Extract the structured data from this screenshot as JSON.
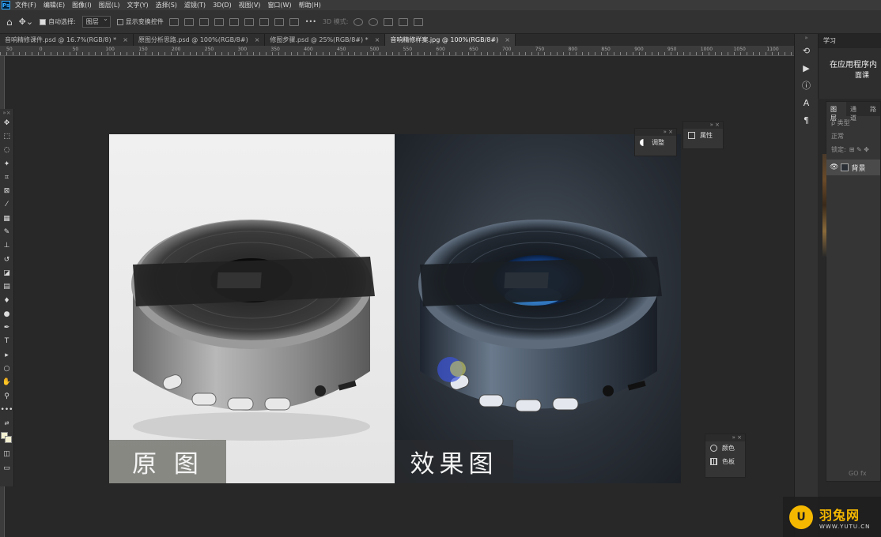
{
  "menubar": {
    "app_logo": "Ps",
    "items": [
      "文件(F)",
      "编辑(E)",
      "图像(I)",
      "图层(L)",
      "文字(Y)",
      "选择(S)",
      "滤镜(T)",
      "3D(D)",
      "视图(V)",
      "窗口(W)",
      "帮助(H)"
    ]
  },
  "options": {
    "auto_select_label": "自动选择:",
    "auto_select_value": "图层",
    "show_transform_label": "显示变换控件",
    "mode_3d_label": "3D 模式:",
    "more_label": "•••"
  },
  "tabs": [
    {
      "label": "音响精修课件.psd @ 16.7%(RGB/8) *"
    },
    {
      "label": "原图分析思路.psd @ 100%(RGB/8#)"
    },
    {
      "label": "修图步骤.psd @ 25%(RGB/8#) *"
    },
    {
      "label": "音响精修样案.jpg @ 100%(RGB/8#)"
    }
  ],
  "ruler": {
    "labels": [
      "50",
      "0",
      "50",
      "100",
      "150",
      "200",
      "250",
      "300",
      "350",
      "400",
      "450",
      "500",
      "550",
      "600",
      "650",
      "700",
      "750",
      "800",
      "850",
      "900",
      "950",
      "1000",
      "1050",
      "1100",
      "1150",
      "1200",
      "1250"
    ]
  },
  "canvas": {
    "left_label": "原 图",
    "right_label": "效果图"
  },
  "panels": {
    "adjust": "调整",
    "properties": "属性",
    "color": "颜色",
    "swatches": "色板"
  },
  "learn": {
    "tab": "学习",
    "line1": "在应用程序内",
    "line2": "面课"
  },
  "layers": {
    "tabs": [
      "图层",
      "通道",
      "路"
    ],
    "kind": "ρ 类型",
    "blend": "正常",
    "lock": "锁定:",
    "layer_name": "背景",
    "footer": "GO fx"
  },
  "watermark": {
    "logo": "U",
    "name": "羽兔网",
    "url": "WWW.YUTU.CN"
  }
}
